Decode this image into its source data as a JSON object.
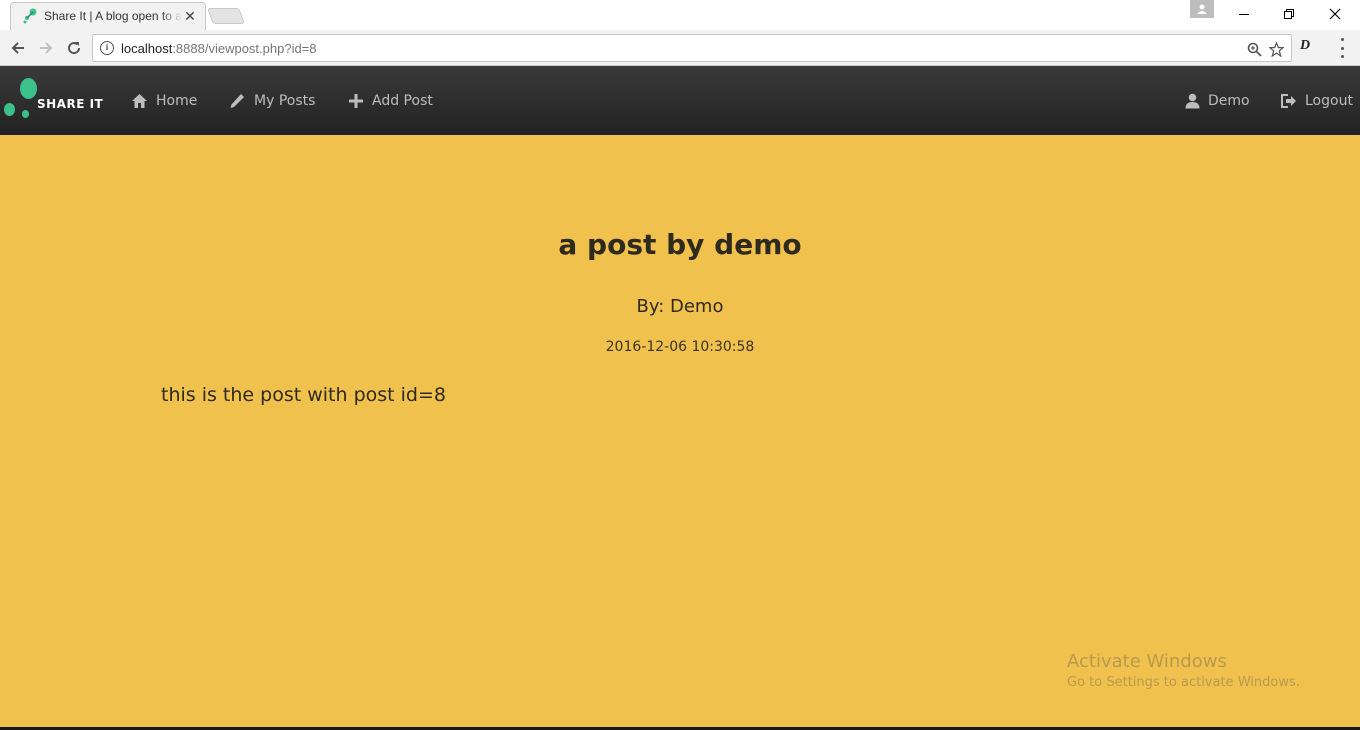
{
  "browser": {
    "tab_title": "Share It | A blog open to all",
    "tab_close": "✕",
    "url_host": "localhost",
    "url_rest": ":8888/viewpost.php?id=8",
    "info_glyph": "i",
    "extension_glyph": "D"
  },
  "navbar": {
    "brand": "SHARE IT",
    "brand_color": "#3cc18b",
    "items": [
      {
        "label": "Home",
        "icon": "home-icon"
      },
      {
        "label": "My Posts",
        "icon": "pencil-icon"
      },
      {
        "label": "Add Post",
        "icon": "plus-icon"
      }
    ],
    "right": [
      {
        "label": "Demo",
        "icon": "user-icon"
      },
      {
        "label": "Logout",
        "icon": "logout-icon"
      }
    ]
  },
  "post": {
    "title": "a post by demo",
    "author": "By: Demo",
    "date": "2016-12-06 10:30:58",
    "body": "this is the post with post id=8"
  },
  "watermark": {
    "title": "Activate Windows",
    "subtitle": "Go to Settings to activate Windows."
  },
  "colors": {
    "page_background": "#f0c14d",
    "navbar_background": "#2b2b2b",
    "nav_text": "#bdbdbd"
  }
}
